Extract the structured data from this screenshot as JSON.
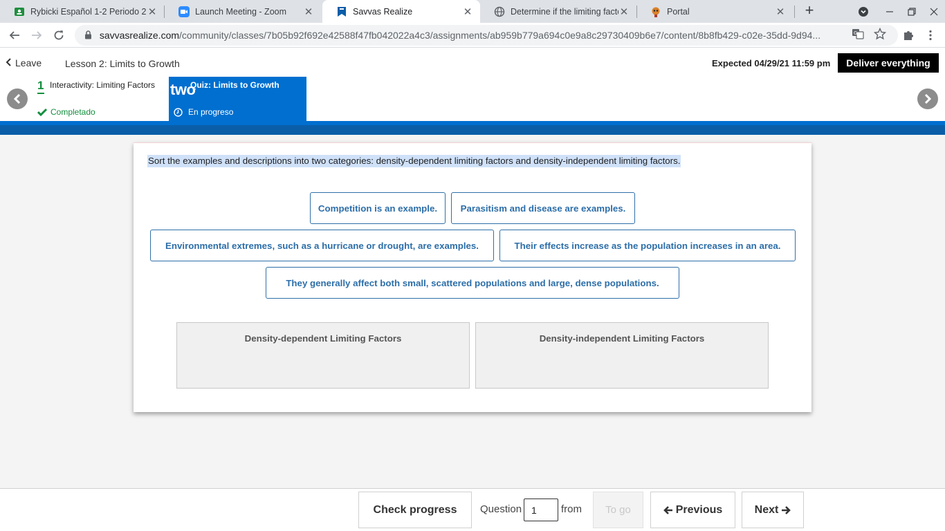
{
  "browser": {
    "tabs": [
      {
        "title": "Rybicki Español 1-2 Periodo 2",
        "icon": "classroom-icon"
      },
      {
        "title": "Launch Meeting - Zoom",
        "icon": "zoom-icon"
      },
      {
        "title": "Savvas Realize",
        "icon": "savvas-icon"
      },
      {
        "title": "Determine if the limiting factor",
        "icon": "globe-icon"
      },
      {
        "title": "Portal",
        "icon": "portal-icon"
      }
    ],
    "url_host": "savvasrealize.com",
    "url_path": "/community/classes/7b05b92f692e42588f47fb042022a4c3/assignments/ab959b779a694c0e9a8c29730409b6e7/content/8b8fb429-c02e-35dd-9d94..."
  },
  "header": {
    "leave_label": "Leave",
    "lesson_title": "Lesson 2: Limits to Growth",
    "expected": "Expected 04/29/21 11:59 pm",
    "deliver_label": "Deliver everything"
  },
  "steps": [
    {
      "number": "1",
      "title": "Interactivity: Limiting Factors",
      "status": "Completado"
    },
    {
      "number": "two",
      "title": "Quiz: Limits to Growth",
      "status": "En progreso"
    }
  ],
  "activity": {
    "prompt": "Sort the examples and descriptions into two categories: density-dependent limiting factors and density-independent limiting factors.",
    "chips": [
      "Competition is an example.",
      "Parasitism and disease are examples.",
      "Environmental extremes, such as a hurricane or drought, are examples.",
      "Their effects increase as the population increases in an area.",
      "They generally affect both small, scattered populations and large, dense populations."
    ],
    "bins": [
      "Density-dependent Limiting Factors",
      "Density-independent Limiting Factors"
    ]
  },
  "footer": {
    "check_progress": "Check progress",
    "question_label": "Question",
    "question_value": "1",
    "from_label": "from",
    "to_go": "To go",
    "previous": "Previous",
    "next": "Next"
  },
  "colors": {
    "accent_blue": "#006fcf",
    "complete_green": "#138f3e",
    "chip_text": "#2c6ea8"
  }
}
